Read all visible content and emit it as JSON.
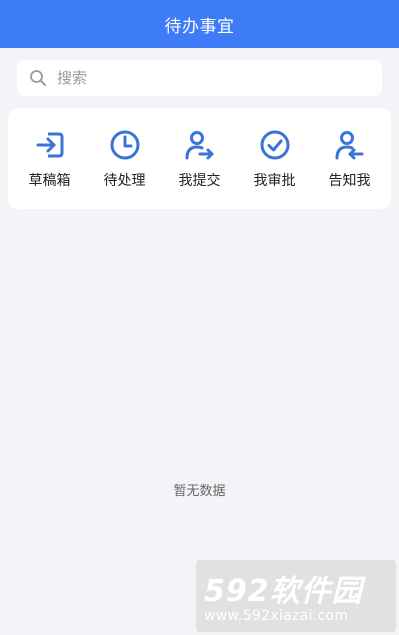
{
  "header": {
    "title": "待办事宜",
    "background_color": "#3d7cf6"
  },
  "search": {
    "placeholder": "搜索",
    "value": "",
    "icon": "search-icon"
  },
  "actions": [
    {
      "label": "草稿箱",
      "icon": "inbox-arrow-icon"
    },
    {
      "label": "待处理",
      "icon": "clock-icon"
    },
    {
      "label": "我提交",
      "icon": "user-arrow-right-icon"
    },
    {
      "label": "我审批",
      "icon": "check-circle-icon"
    },
    {
      "label": "告知我",
      "icon": "user-arrow-left-icon"
    }
  ],
  "accent_color": "#3a74d8",
  "empty_state": {
    "text": "暂无数据"
  },
  "watermark": {
    "brand": "592软件园",
    "url": "www.592xiazai.com"
  }
}
